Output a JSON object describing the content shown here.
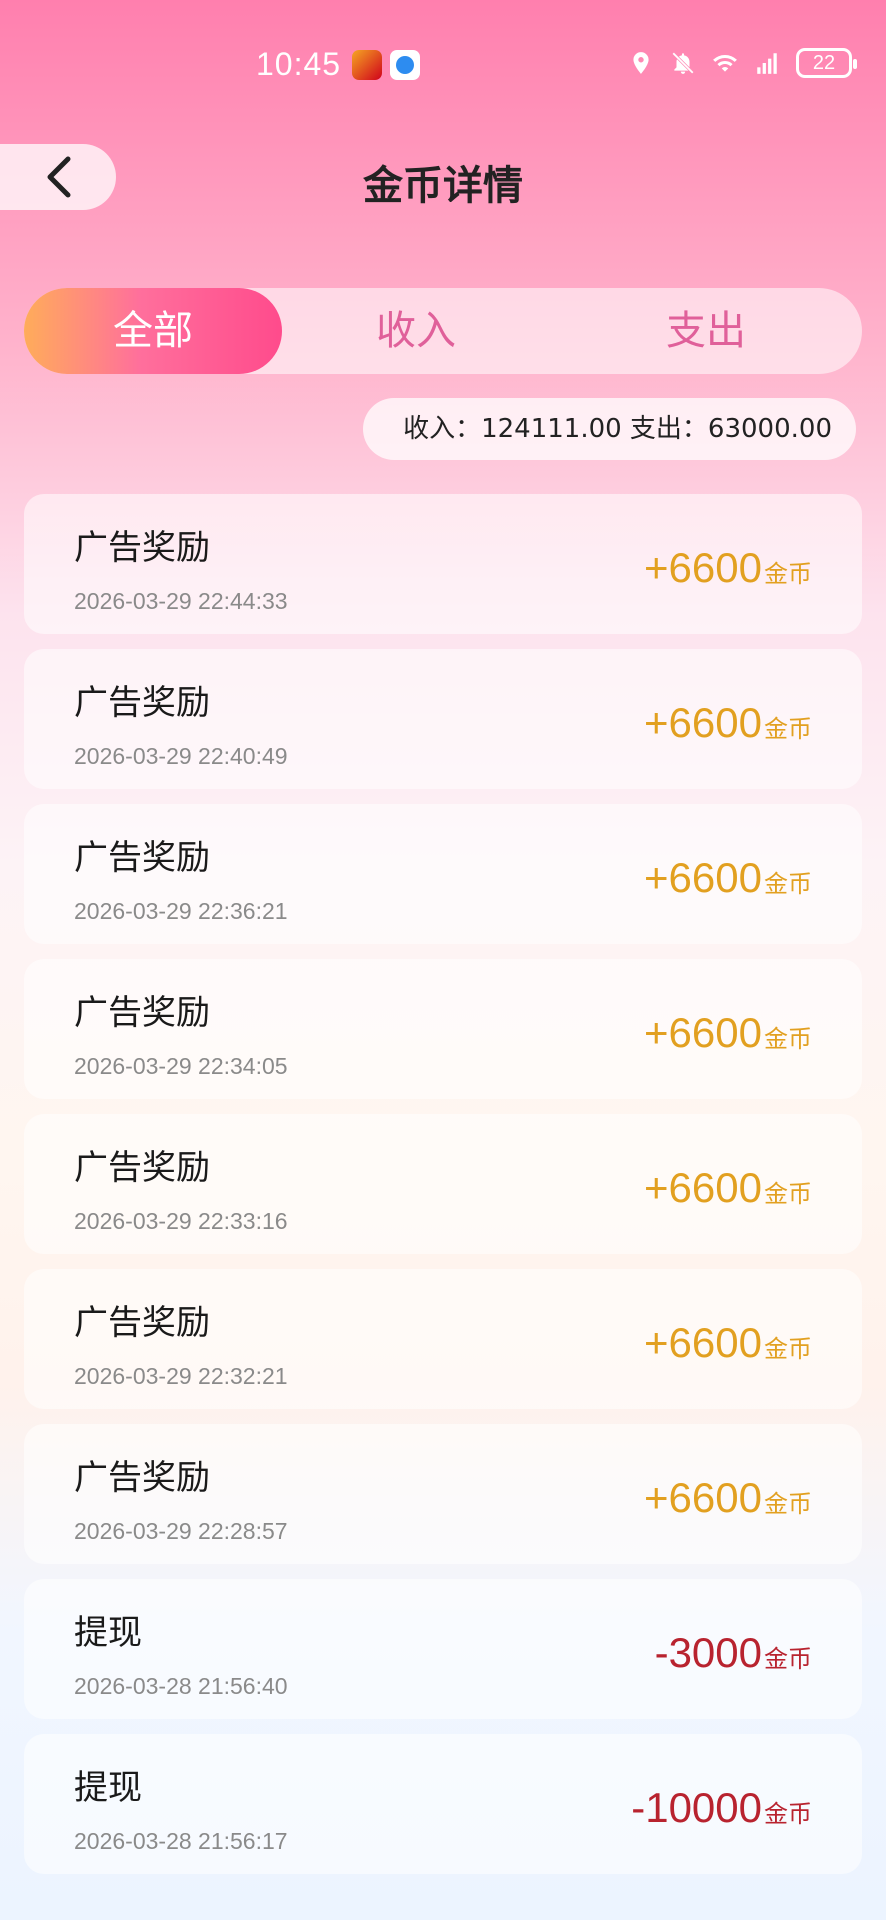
{
  "status_bar": {
    "time": "10:45",
    "battery": "22"
  },
  "header": {
    "title": "金币详情"
  },
  "tabs": [
    {
      "label": "全部",
      "active": true
    },
    {
      "label": "收入",
      "active": false
    },
    {
      "label": "支出",
      "active": false
    }
  ],
  "summary": {
    "text": "收入：124111.00 支出：63000.00"
  },
  "records": [
    {
      "title": "广告奖励",
      "time": "2026-03-29 22:44:33",
      "amount": "+6600",
      "unit": "金币",
      "type": "income"
    },
    {
      "title": "广告奖励",
      "time": "2026-03-29 22:40:49",
      "amount": "+6600",
      "unit": "金币",
      "type": "income"
    },
    {
      "title": "广告奖励",
      "time": "2026-03-29 22:36:21",
      "amount": "+6600",
      "unit": "金币",
      "type": "income"
    },
    {
      "title": "广告奖励",
      "time": "2026-03-29 22:34:05",
      "amount": "+6600",
      "unit": "金币",
      "type": "income"
    },
    {
      "title": "广告奖励",
      "time": "2026-03-29 22:33:16",
      "amount": "+6600",
      "unit": "金币",
      "type": "income"
    },
    {
      "title": "广告奖励",
      "time": "2026-03-29 22:32:21",
      "amount": "+6600",
      "unit": "金币",
      "type": "income"
    },
    {
      "title": "广告奖励",
      "time": "2026-03-29 22:28:57",
      "amount": "+6600",
      "unit": "金币",
      "type": "income"
    },
    {
      "title": "提现",
      "time": "2026-03-28 21:56:40",
      "amount": "-3000",
      "unit": "金币",
      "type": "expense"
    },
    {
      "title": "提现",
      "time": "2026-03-28 21:56:17",
      "amount": "-10000",
      "unit": "金币",
      "type": "expense"
    }
  ],
  "colors": {
    "income": "#e2a020",
    "expense": "#b8232f",
    "accent": "#ff4b8c"
  }
}
